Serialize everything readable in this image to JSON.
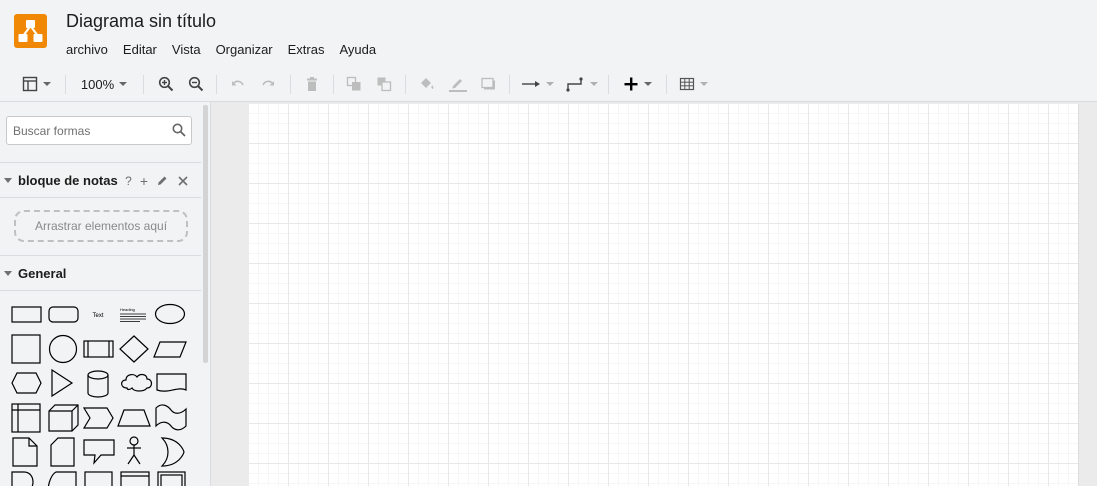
{
  "app": {
    "title": "Diagrama sin título",
    "accent_color": "#f08705",
    "logo_icon": "drawio-logo-icon"
  },
  "menu": [
    "archivo",
    "Editar",
    "Vista",
    "Organizar",
    "Extras",
    "Ayuda"
  ],
  "toolbar": {
    "zoom": "100%",
    "buttons": [
      "format-panel-icon",
      "zoom-in-icon",
      "zoom-out-icon",
      "undo-icon",
      "redo-icon",
      "delete-icon",
      "to-front-icon",
      "to-back-icon",
      "fill-color-icon",
      "line-color-icon",
      "shadow-icon",
      "connection-icon",
      "waypoints-icon",
      "insert-icon",
      "table-icon"
    ]
  },
  "sidebar": {
    "search_placeholder": "Buscar formas",
    "scratchpad": {
      "title": "bloque de notas",
      "help": "?",
      "add": "+",
      "drop_hint": "Arrastrar elementos aquí"
    },
    "general": {
      "title": "General",
      "text_shape_label": "Text",
      "heading_shape_label": "Heading"
    }
  }
}
